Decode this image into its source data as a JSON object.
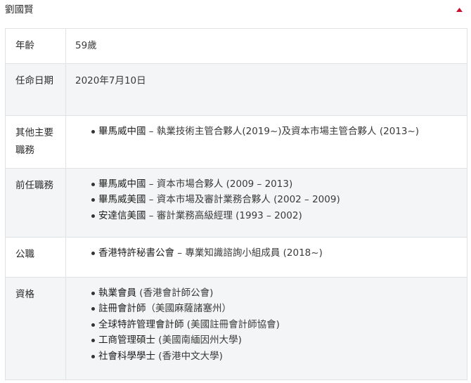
{
  "header": {
    "title": "劉國賢"
  },
  "rows": [
    {
      "label": "年齡",
      "value": "59歲"
    },
    {
      "label": "任命日期",
      "value": "2020年7月10日"
    },
    {
      "label": "其他主要職務",
      "items": [
        {
          "org": "畢馬威中國",
          "sep": " – ",
          "detail": "執業技術主管合夥人(2019~)及資本市場主管合夥人 (2013~)"
        }
      ]
    },
    {
      "label": "前任職務",
      "items": [
        {
          "org": "畢馬威中國",
          "sep": " – ",
          "detail": "資本市場合夥人 (2009 – 2013)"
        },
        {
          "org": "畢馬威美國",
          "sep": " – ",
          "detail": "資本市場及審計業務合夥人 (2002 – 2009)"
        },
        {
          "org": "安達信美國",
          "sep": " – ",
          "detail": "審計業務高級經理 (1993 – 2002)"
        }
      ]
    },
    {
      "label": "公職",
      "items": [
        {
          "org": "香港特許秘書公會",
          "sep": " – ",
          "detail": "專業知識諮詢小組成員 (2018~)"
        }
      ]
    },
    {
      "label": "資格",
      "items": [
        {
          "org": "執業會員",
          "sep": " ",
          "detail": "(香港會計師公會)"
        },
        {
          "org": "註冊會計師",
          "sep": "",
          "detail": "（美國麻薩諸塞州）"
        },
        {
          "org": "全球特許管理會計師",
          "sep": " ",
          "detail": "(美國註冊會計師協會)"
        },
        {
          "org": "工商管理碩士",
          "sep": " ",
          "detail": "(美國南緬因州大學)"
        },
        {
          "org": "社會科學學士",
          "sep": " ",
          "detail": "(香港中文大學)"
        }
      ]
    }
  ],
  "icons": {
    "collapse": "triangle-up-icon"
  },
  "colors": {
    "accent": "#c8102e",
    "border": "#dfe3e6",
    "row_alt": "#f4f5f6"
  }
}
